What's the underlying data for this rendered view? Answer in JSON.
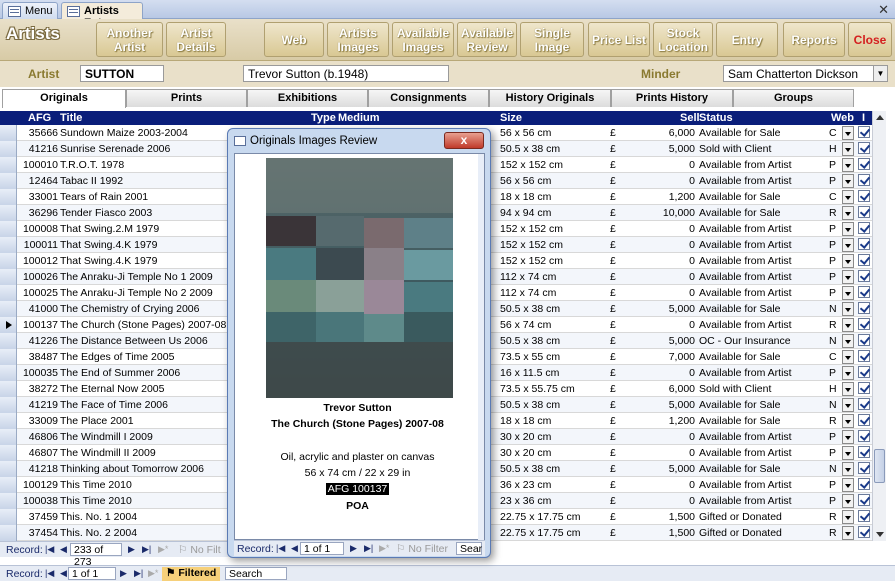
{
  "doc_tabs": [
    {
      "label": "Menu",
      "active": false
    },
    {
      "label": "Artists Entry",
      "active": true
    }
  ],
  "header": {
    "title": "Artists",
    "buttons": [
      {
        "label": "Another\nArtist"
      },
      {
        "label": "Artist\nDetails"
      },
      {
        "label": "Web"
      },
      {
        "label": "Artists\nImages"
      },
      {
        "label": "Available\nImages"
      },
      {
        "label": "Available\nReview"
      },
      {
        "label": "Single\nImage"
      },
      {
        "label": "Price List"
      },
      {
        "label": "Stock\nLocation"
      },
      {
        "label": "Entry"
      },
      {
        "label": "Reports"
      },
      {
        "label": "Close"
      }
    ]
  },
  "filter": {
    "artist_label": "Artist",
    "artist_code": "SUTTON",
    "artist_name": "Trevor Sutton (b.1948)",
    "minder_label": "Minder",
    "minder_value": "Sam Chatterton Dickson"
  },
  "sub_tabs": [
    "Originals",
    "Prints",
    "Exhibitions",
    "Consignments",
    "History Originals",
    "Prints History",
    "Groups"
  ],
  "columns": {
    "afg": "AFG",
    "title": "Title",
    "type": "Type",
    "medium": "Medium",
    "size": "Size",
    "sell": "Sell",
    "status": "Status",
    "web": "Web",
    "i": "I"
  },
  "rows": [
    {
      "afg": "35666",
      "title": "Sundown Maize 2003-2004",
      "size": "56 x 56 cm",
      "cur": "£",
      "sell": "6,000",
      "status": "Available for Sale",
      "web": "C"
    },
    {
      "afg": "41216",
      "title": "Sunrise Serenade 2006",
      "size": "50.5 x 38 cm",
      "cur": "£",
      "sell": "5,000",
      "status": "Sold with Client",
      "web": "H"
    },
    {
      "afg": "100010",
      "title": "T.R.O.T. 1978",
      "size": "152 x 152 cm",
      "cur": "£",
      "sell": "0",
      "status": "Available from Artist",
      "web": "P"
    },
    {
      "afg": "12464",
      "title": "Tabac II 1992",
      "size": "56 x 56 cm",
      "cur": "£",
      "sell": "0",
      "status": "Available from Artist",
      "web": "P"
    },
    {
      "afg": "33001",
      "title": "Tears of Rain 2001",
      "size": "18 x 18 cm",
      "cur": "£",
      "sell": "1,200",
      "status": "Available for Sale",
      "web": "C"
    },
    {
      "afg": "36296",
      "title": "Tender Fiasco 2003",
      "size": "94 x 94 cm",
      "cur": "£",
      "sell": "10,000",
      "status": "Available for Sale",
      "web": "R"
    },
    {
      "afg": "100008",
      "title": "That Swing.2.M 1979",
      "size": "152 x 152 cm",
      "cur": "£",
      "sell": "0",
      "status": "Available from Artist",
      "web": "P"
    },
    {
      "afg": "100011",
      "title": "That Swing.4.K 1979",
      "size": "152 x 152 cm",
      "cur": "£",
      "sell": "0",
      "status": "Available from Artist",
      "web": "P"
    },
    {
      "afg": "100012",
      "title": "That Swing.4.K 1979",
      "size": "152 x 152 cm",
      "cur": "£",
      "sell": "0",
      "status": "Available from Artist",
      "web": "P"
    },
    {
      "afg": "100026",
      "title": "The Anraku-Ji Temple No 1 2009",
      "size": "112 x 74 cm",
      "cur": "£",
      "sell": "0",
      "status": "Available from Artist",
      "web": "P"
    },
    {
      "afg": "100025",
      "title": "The Anraku-Ji Temple No 2 2009",
      "size": "112 x 74 cm",
      "cur": "£",
      "sell": "0",
      "status": "Available from Artist",
      "web": "P"
    },
    {
      "afg": "41000",
      "title": "The Chemistry of Crying 2006",
      "size": "50.5 x 38 cm",
      "cur": "£",
      "sell": "5,000",
      "status": "Available for Sale",
      "web": "N"
    },
    {
      "afg": "100137",
      "title": "The Church (Stone Pages) 2007-08",
      "size": "56 x 74 cm",
      "cur": "£",
      "sell": "0",
      "status": "Available from Artist",
      "web": "R",
      "current": true
    },
    {
      "afg": "41226",
      "title": "The Distance Between Us 2006",
      "size": "50.5 x 38 cm",
      "cur": "£",
      "sell": "5,000",
      "status": "OC - Our Insurance",
      "web": "N"
    },
    {
      "afg": "38487",
      "title": "The Edges of Time 2005",
      "size": "73.5 x 55 cm",
      "cur": "£",
      "sell": "7,000",
      "status": "Available for Sale",
      "web": "C"
    },
    {
      "afg": "100035",
      "title": "The End of Summer 2006",
      "size": "16 x 11.5 cm",
      "cur": "£",
      "sell": "0",
      "status": "Available from Artist",
      "web": "P"
    },
    {
      "afg": "38272",
      "title": "The Eternal Now 2005",
      "size": "73.5 x 55.75 cm",
      "cur": "£",
      "sell": "6,000",
      "status": "Sold with Client",
      "web": "H"
    },
    {
      "afg": "41219",
      "title": "The Face of Time 2006",
      "size": "50.5 x 38 cm",
      "cur": "£",
      "sell": "5,000",
      "status": "Available for Sale",
      "web": "N"
    },
    {
      "afg": "33009",
      "title": "The Place 2001",
      "size": "18 x 18 cm",
      "cur": "£",
      "sell": "1,200",
      "status": "Available for Sale",
      "web": "R"
    },
    {
      "afg": "46806",
      "title": "The Windmill I 2009",
      "size": "30 x 20 cm",
      "cur": "£",
      "sell": "0",
      "status": "Available from Artist",
      "web": "P"
    },
    {
      "afg": "46807",
      "title": "The Windmill II 2009",
      "size": "30 x 20 cm",
      "cur": "£",
      "sell": "0",
      "status": "Available from Artist",
      "web": "P"
    },
    {
      "afg": "41218",
      "title": "Thinking about Tomorrow 2006",
      "size": "50.5 x 38 cm",
      "cur": "£",
      "sell": "5,000",
      "status": "Available for Sale",
      "web": "N"
    },
    {
      "afg": "100129",
      "title": "This Time 2010",
      "size": "36 x 23 cm",
      "cur": "£",
      "sell": "0",
      "status": "Available from Artist",
      "web": "P"
    },
    {
      "afg": "100038",
      "title": "This Time 2010",
      "size": "23 x 36 cm",
      "cur": "£",
      "sell": "0",
      "status": "Available from Artist",
      "web": "P"
    },
    {
      "afg": "37459",
      "title": "This. No. 1 2004",
      "size": "22.75 x 17.75 cm",
      "cur": "£",
      "sell": "1,500",
      "status": "Gifted or Donated",
      "web": "R"
    },
    {
      "afg": "37454",
      "title": "This. No. 2 2004",
      "size": "22.75 x 17.75 cm",
      "cur": "£",
      "sell": "1,500",
      "status": "Gifted or Donated",
      "web": "R"
    }
  ],
  "inner_nav": {
    "label": "Record:",
    "record": "233 of 273",
    "filter": "No Filt"
  },
  "outer_nav": {
    "label": "Record:",
    "record": "1 of 1",
    "filter": "Filtered",
    "search": "Search"
  },
  "popup": {
    "title": "Originals Images Review",
    "close": "x",
    "artist": "Trevor Sutton",
    "work_title": "The Church (Stone Pages) 2007-08",
    "medium": "Oil, acrylic and plaster on canvas",
    "dimensions": "56 x 74 cm / 22 x 29 in",
    "afg": "AFG  100137",
    "price": "POA",
    "nav": {
      "label": "Record:",
      "record": "1 of 1",
      "filter": "No Filter",
      "search": "Sear"
    }
  }
}
